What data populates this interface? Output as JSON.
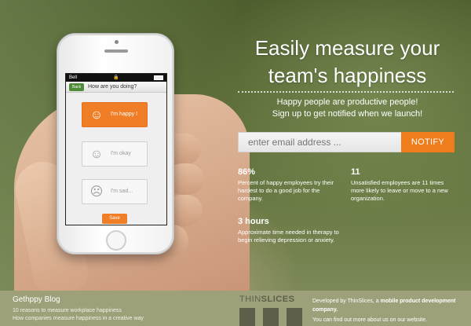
{
  "phone": {
    "status_carrier": "Bell",
    "back_label": "Back",
    "question": "How are you doing?",
    "moods": [
      {
        "label": "I'm happy !",
        "face": "☺"
      },
      {
        "label": "I'm okay",
        "face": "☺"
      },
      {
        "label": "I'm sad...",
        "face": "☹"
      }
    ],
    "save_label": "Save"
  },
  "hero": {
    "headline_line1": "Easily measure your",
    "headline_line2": "team's happiness",
    "sub_line1": "Happy people are productive people!",
    "sub_line2": "Sign up to get notified when we launch!"
  },
  "signup": {
    "email_placeholder": "enter email address ...",
    "notify_label": "NOTIFY"
  },
  "stats": [
    {
      "value": "86%",
      "desc": "Percent of happy employees try their hardest to do a good job for the company."
    },
    {
      "value": "11",
      "desc": "Unsatisfied employees are 11 times more likely to leave or move to a new organization."
    },
    {
      "value": "3 hours",
      "desc": "Approximate time needed in therapy to begin relieving depression or anxiety."
    }
  ],
  "footer": {
    "blog_title": "Gethppy Blog",
    "blog_links": [
      "10 reasons to measure workplace happiness",
      "How companies measure happiness in a creative way"
    ],
    "logo_light": "THIN",
    "logo_bold": "SLICES",
    "dev_prefix": "Developed by ThinSlices, a",
    "dev_bold": "mobile product development company.",
    "more_prefix": "You can",
    "more_bold": "find out more",
    "more_suffix": "about us on our website."
  },
  "colors": {
    "accent": "#f07d1c",
    "footer_bg": "#9ea07a",
    "back_button": "#4e8c3a"
  },
  "icons": [
    "apple-icon",
    "android-icon",
    "windows-icon",
    "thinslices-logo-icon",
    "smiley-icon",
    "sad-face-icon"
  ]
}
